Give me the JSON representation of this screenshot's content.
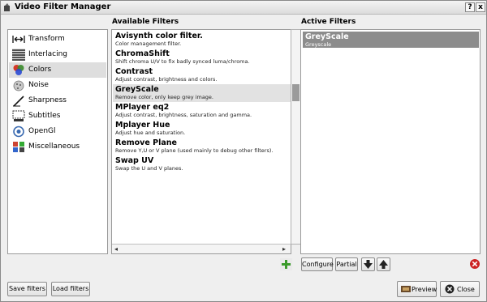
{
  "window": {
    "title": "Video Filter Manager",
    "help_label": "?",
    "close_label": "x"
  },
  "headings": {
    "available": "Available Filters",
    "active": "Active Filters"
  },
  "categories": [
    {
      "label": "Transform",
      "icon": "transform-icon"
    },
    {
      "label": "Interlacing",
      "icon": "interlacing-icon"
    },
    {
      "label": "Colors",
      "icon": "colors-icon"
    },
    {
      "label": "Noise",
      "icon": "noise-icon"
    },
    {
      "label": "Sharpness",
      "icon": "sharpness-icon"
    },
    {
      "label": "Subtitles",
      "icon": "subtitles-icon"
    },
    {
      "label": "OpenGl",
      "icon": "opengl-icon"
    },
    {
      "label": "Miscellaneous",
      "icon": "miscellaneous-icon"
    }
  ],
  "selected_category": "Colors",
  "available_filters": [
    {
      "name": "Avisynth color filter.",
      "desc": "Color management filter."
    },
    {
      "name": "ChromaShift",
      "desc": "Shift chroma U/V to fix badly synced luma/chroma."
    },
    {
      "name": "Contrast",
      "desc": "Adjust contrast, brightness and colors."
    },
    {
      "name": "GreyScale",
      "desc": "Remove color, only keep grey image."
    },
    {
      "name": "MPlayer eq2",
      "desc": "Adjust contrast, brightness, saturation and gamma."
    },
    {
      "name": "Mplayer Hue",
      "desc": "Adjust hue and saturation."
    },
    {
      "name": "Remove Plane",
      "desc": "Remove Y,U or V plane (used mainly to debug other filters)."
    },
    {
      "name": "Swap UV",
      "desc": "Swap the U and V planes."
    }
  ],
  "selected_available": "GreyScale",
  "active_filters": [
    {
      "name": "GreyScale",
      "desc": "Greyscale"
    }
  ],
  "buttons": {
    "configure": "Configure",
    "partial": "Partial",
    "save_filters": "Save filters",
    "load_filters": "Load filters",
    "preview": "Preview",
    "close": "Close"
  },
  "colors": {
    "selection": "#8c8c8c",
    "add": "#3a9a2a",
    "remove": "#cc2222"
  }
}
